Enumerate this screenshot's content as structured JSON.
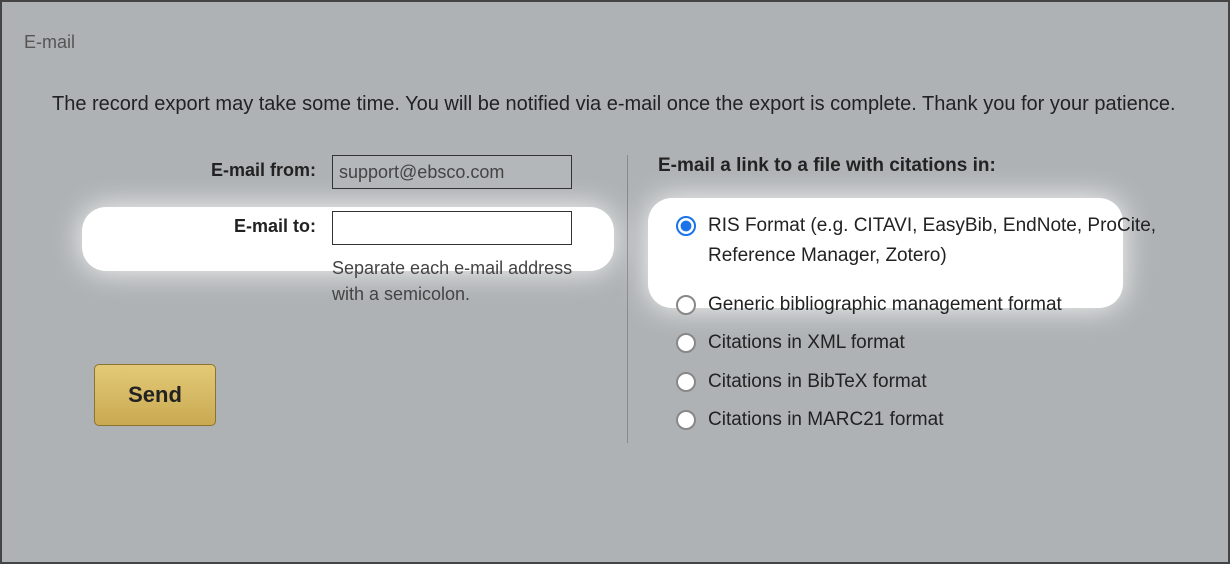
{
  "section": {
    "title": "E-mail"
  },
  "intro": "The record export may take some time. You will be notified via e-mail once the export is complete. Thank you for your patience.",
  "form": {
    "emailFrom": {
      "label": "E-mail from:",
      "value": "support@ebsco.com"
    },
    "emailTo": {
      "label": "E-mail to:",
      "value": "",
      "help": "Separate each e-mail address with a semicolon."
    },
    "sendLabel": "Send"
  },
  "formats": {
    "heading": "E-mail a link to a file with citations in:",
    "selectedIndex": 0,
    "options": [
      "RIS Format (e.g. CITAVI, EasyBib, EndNote, ProCite, Reference Manager, Zotero)",
      "Generic bibliographic management format",
      "Citations in XML format",
      "Citations in BibTeX format",
      "Citations in MARC21 format"
    ]
  }
}
